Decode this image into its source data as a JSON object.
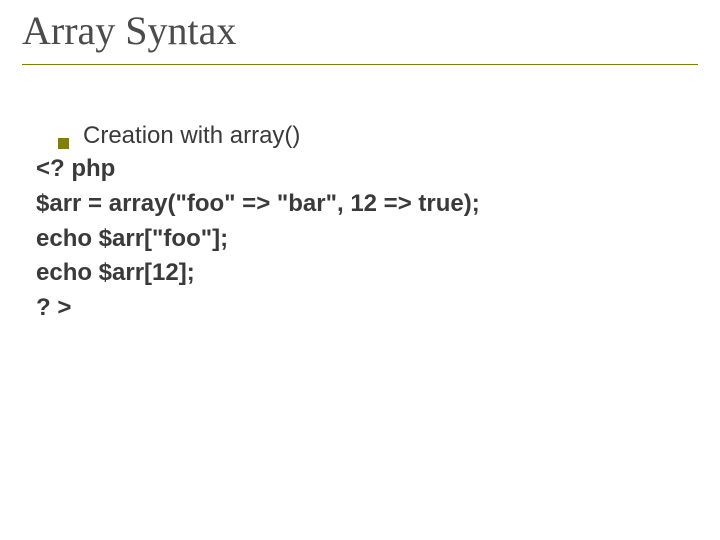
{
  "title": "Array Syntax",
  "bullet": {
    "text": "Creation with array()"
  },
  "code": {
    "line1": "<? php",
    "line2": "$arr = array(\"foo\" => \"bar\", 12 => true);",
    "line3": "echo $arr[\"foo\"];",
    "line4": "echo $arr[12];",
    "line5": "? >"
  }
}
